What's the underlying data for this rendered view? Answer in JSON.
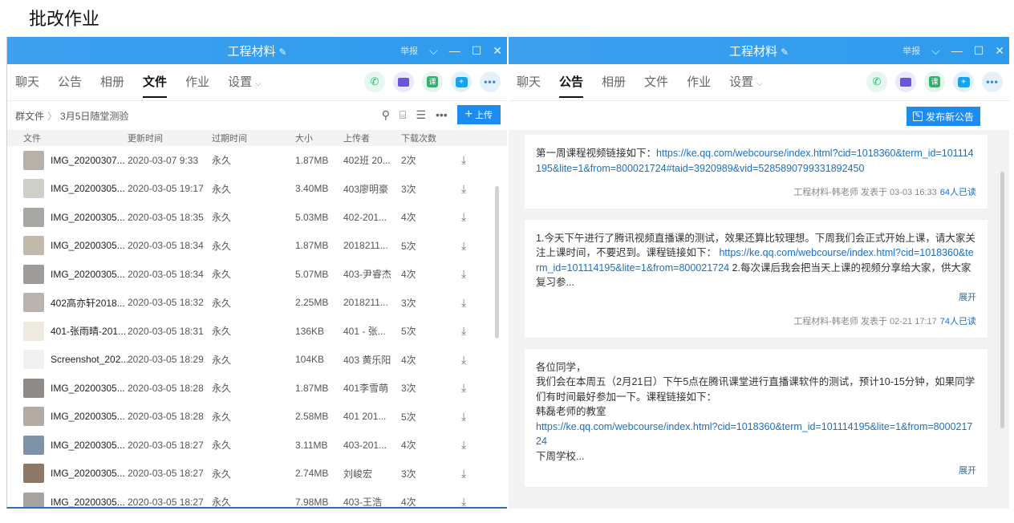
{
  "page_title": "批改作业",
  "left": {
    "window_title": "工程材料",
    "title_edit_icon": "✎",
    "report": "举报",
    "tabs": [
      "聊天",
      "公告",
      "相册",
      "文件",
      "作业",
      "设置"
    ],
    "active_tab": "文件",
    "breadcrumb": {
      "root": "群文件",
      "sep": "〉",
      "current": "3月5日随堂测验"
    },
    "upload_label": "上传",
    "columns": {
      "file": "文件",
      "time": "更新时间",
      "expire": "过期时间",
      "size": "大小",
      "uploader": "上传者",
      "downloads": "下载次数"
    },
    "files": [
      {
        "name": "IMG_20200307...",
        "time": "2020-03-07 9:33",
        "expire": "永久",
        "size": "1.87MB",
        "uploader": "402班 20...",
        "downloads": "2次",
        "thumb": "#b7b1a9"
      },
      {
        "name": "IMG_20200305...",
        "time": "2020-03-05 19:17",
        "expire": "永久",
        "size": "3.40MB",
        "uploader": "403廖明豪",
        "downloads": "3次",
        "thumb": "#cfd1c8"
      },
      {
        "name": "IMG_20200305...",
        "time": "2020-03-05 18:35",
        "expire": "永久",
        "size": "5.03MB",
        "uploader": "402-201...",
        "downloads": "4次",
        "thumb": "#a9a7a4"
      },
      {
        "name": "IMG_20200305...",
        "time": "2020-03-05 18:34",
        "expire": "永久",
        "size": "1.87MB",
        "uploader": "2018211...",
        "downloads": "5次",
        "thumb": "#c2b9ad"
      },
      {
        "name": "IMG_20200305...",
        "time": "2020-03-05 18:34",
        "expire": "永久",
        "size": "5.07MB",
        "uploader": "403-尹睿杰",
        "downloads": "4次",
        "thumb": "#9e9c9a"
      },
      {
        "name": "402高亦轩2018...",
        "time": "2020-03-05 18:32",
        "expire": "永久",
        "size": "2.25MB",
        "uploader": "2018211...",
        "downloads": "3次",
        "thumb": "#b9b3ad"
      },
      {
        "name": "401-张雨晴-201...",
        "time": "2020-03-05 18:31",
        "expire": "永久",
        "size": "136KB",
        "uploader": "401 - 张...",
        "downloads": "5次",
        "thumb": "#eeeae0"
      },
      {
        "name": "Screenshot_202...",
        "time": "2020-03-05 18:29",
        "expire": "永久",
        "size": "104KB",
        "uploader": "403 黄乐阳",
        "downloads": "4次",
        "thumb": "#f1f1f1"
      },
      {
        "name": "IMG_20200305...",
        "time": "2020-03-05 18:28",
        "expire": "永久",
        "size": "1.87MB",
        "uploader": "401李雪萌",
        "downloads": "3次",
        "thumb": "#8e8b89"
      },
      {
        "name": "IMG_20200305...",
        "time": "2020-03-05 18:28",
        "expire": "永久",
        "size": "2.58MB",
        "uploader": "401 201...",
        "downloads": "5次",
        "thumb": "#b4aca4"
      },
      {
        "name": "IMG_20200305...",
        "time": "2020-03-05 18:27",
        "expire": "永久",
        "size": "3.11MB",
        "uploader": "403-201...",
        "downloads": "4次",
        "thumb": "#7e92a8"
      },
      {
        "name": "IMG_20200305...",
        "time": "2020-03-05 18:27",
        "expire": "永久",
        "size": "2.74MB",
        "uploader": "刘峻宏",
        "downloads": "3次",
        "thumb": "#8d7766"
      },
      {
        "name": "IMG_20200305...",
        "time": "2020-03-05 18:27",
        "expire": "永久",
        "size": "7.98MB",
        "uploader": "403-王浩",
        "downloads": "4次",
        "thumb": "#a7a39e"
      }
    ]
  },
  "right": {
    "window_title": "工程材料",
    "title_edit_icon": "✎",
    "report": "举报",
    "tabs": [
      "聊天",
      "公告",
      "相册",
      "文件",
      "作业",
      "设置"
    ],
    "active_tab": "公告",
    "publish_label": "发布新公告",
    "notices": [
      {
        "text1": "第一周课程视频链接如下：",
        "link": "https://ke.qq.com/webcourse/index.html?cid=1018360&term_id=101114195&lite=1&from=800021724#taid=3920989&vid=5285890799331892450",
        "text2": "",
        "meta": "工程材料-韩老师 发表于 03-03 16:33",
        "reads": "64人已读",
        "expand": ""
      },
      {
        "text1": "1.今天下午进行了腾讯视频直播课的测试，效果还算比较理想。下周我们会正式开始上课，请大家关注上课时间，不要迟到。课程链接如下： ",
        "link": "https://ke.qq.com/webcourse/index.html?cid=1018360&term_id=101114195&lite=1&from=800021724",
        "text2": " 2.每次课后我会把当天上课的视频分享给大家，供大家复习参...",
        "meta": "工程材料-韩老师 发表于 02-21 17:17",
        "reads": "74人已读",
        "expand": "展开"
      },
      {
        "text1": "各位同学，\n我们会在本周五（2月21日）下午5点在腾讯课堂进行直播课软件的测试，预计10-15分钟，如果同学们有时间最好参加一下。课程链接如下：\n韩磊老师的教室\n",
        "link": "https://ke.qq.com/webcourse/index.html?cid=1018360&term_id=101114195&lite=1&from=800021724",
        "text2": "\n下周学校...",
        "meta": "",
        "reads": "",
        "expand": "展开"
      }
    ]
  }
}
